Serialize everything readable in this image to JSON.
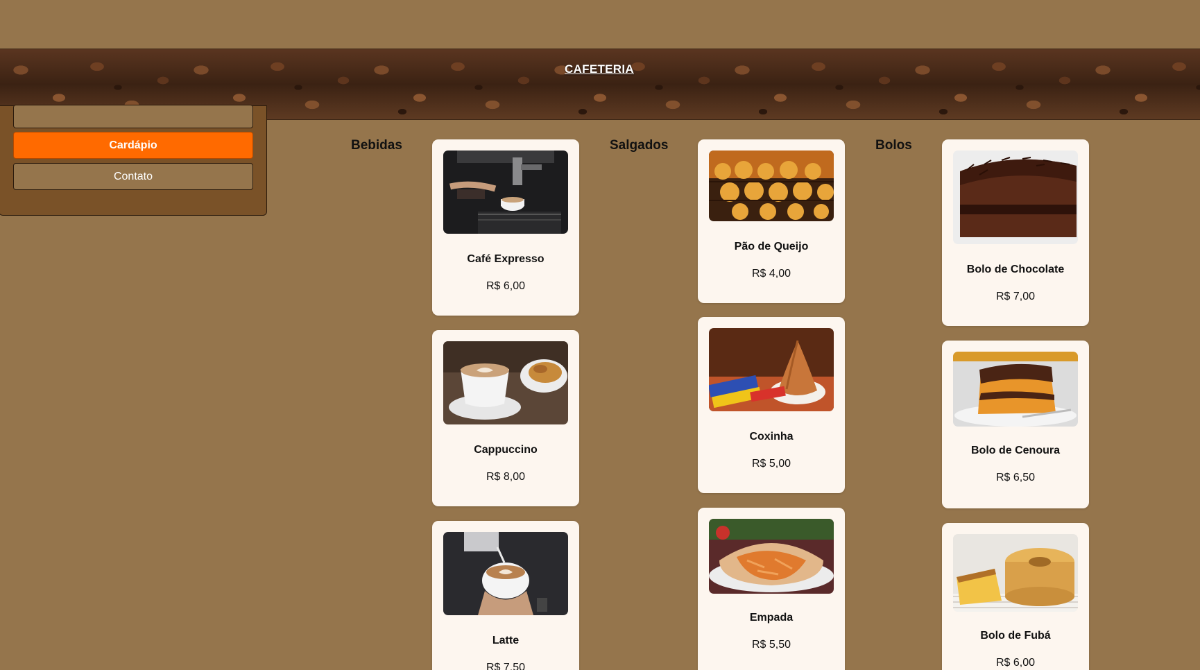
{
  "header": {
    "brand": "CAFETERIA"
  },
  "sidebar": {
    "items": [
      {
        "label": ""
      },
      {
        "label": "Cardápio"
      },
      {
        "label": "Contato"
      }
    ]
  },
  "menu": {
    "bebidas": {
      "title": "Bebidas",
      "items": [
        {
          "name": "Café Expresso",
          "price": "R$ 6,00",
          "icon": "espresso-machine-photo"
        },
        {
          "name": "Cappuccino",
          "price": "R$ 8,00",
          "icon": "cappuccino-photo"
        },
        {
          "name": "Latte",
          "price": "R$ 7,50",
          "icon": "latte-photo"
        }
      ]
    },
    "salgados": {
      "title": "Salgados",
      "items": [
        {
          "name": "Pão de Queijo",
          "price": "R$ 4,00",
          "icon": "pao-de-queijo-photo"
        },
        {
          "name": "Coxinha",
          "price": "R$ 5,00",
          "icon": "coxinha-photo"
        },
        {
          "name": "Empada",
          "price": "R$ 5,50",
          "icon": "empada-photo"
        }
      ]
    },
    "bolos": {
      "title": "Bolos",
      "items": [
        {
          "name": "Bolo de Chocolate",
          "price": "R$ 7,00",
          "icon": "chocolate-cake-photo"
        },
        {
          "name": "Bolo de Cenoura",
          "price": "R$ 6,50",
          "icon": "carrot-cake-photo"
        },
        {
          "name": "Bolo de Fubá",
          "price": "R$ 6,00",
          "icon": "corn-cake-photo"
        }
      ]
    }
  },
  "colors": {
    "background": "#95754c",
    "sidebar": "#7a5228",
    "active": "#ff6a00",
    "card": "#fdf6ef"
  }
}
